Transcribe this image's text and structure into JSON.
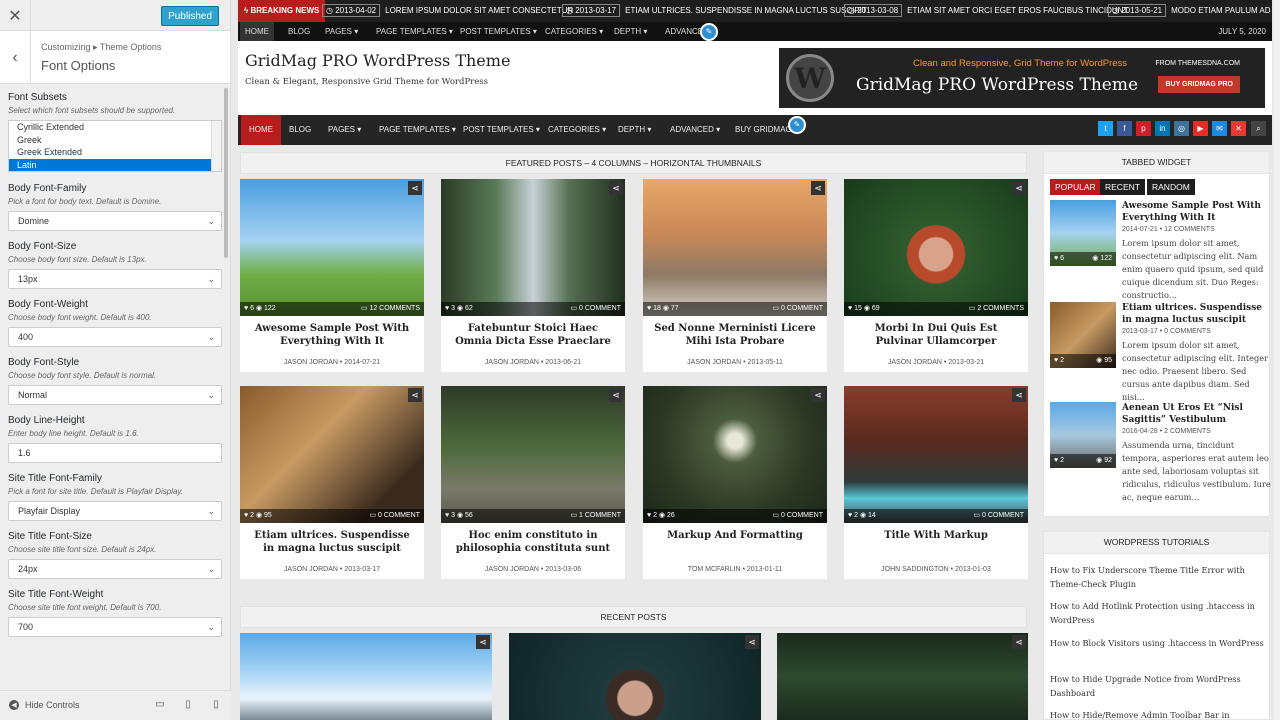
{
  "customizer": {
    "close_glyph": "✕",
    "publish_label": "Published",
    "back_glyph": "‹",
    "breadcrumb": "Customizing ▸ Theme Options",
    "section_title": "Font Options",
    "subsets": {
      "label": "Font Subsets",
      "desc": "Select which font subsets should be supported.",
      "items": [
        "Cyrillic Extended",
        "Greek",
        "Greek Extended",
        "Latin"
      ]
    },
    "controls": [
      {
        "label": "Body Font-Family",
        "desc": "Pick a font for body text. Default is Domine.",
        "value": "Domine"
      },
      {
        "label": "Body Font-Size",
        "desc": "Choose body font size. Default is 13px.",
        "value": "13px"
      },
      {
        "label": "Body Font-Weight",
        "desc": "Choose body font weight. Default is 400.",
        "value": "400"
      },
      {
        "label": "Body Font-Style",
        "desc": "Choose body font style. Default is normal.",
        "value": "Normal"
      },
      {
        "label": "Body Line-Height",
        "desc": "Enter body line height. Default is 1.6.",
        "value": "1.6"
      },
      {
        "label": "Site Title Font-Family",
        "desc": "Pick a font for site title. Default is Playfair Display.",
        "value": "Playfair Display"
      },
      {
        "label": "Site Title Font-Size",
        "desc": "Choose site title font size. Default is 24px.",
        "value": "24px"
      },
      {
        "label": "Site Title Font-Weight",
        "desc": "Choose site title font weight. Default is 700.",
        "value": "700"
      }
    ],
    "hide_controls": "Hide Controls"
  },
  "ticker": {
    "label": "BREAKING NEWS",
    "items": [
      {
        "date": "2013-04-02",
        "text": "LOREM IPSUM DOLOR SIT AMET CONSECTETUR"
      },
      {
        "date": "2013-03-17",
        "text": "ETIAM ULTRICES. SUSPENDISSE IN MAGNA LUCTUS SUSCIPIT"
      },
      {
        "date": "2013-03-08",
        "text": "ETIAM SIT AMET ORCI EGET EROS FAUCIBUS TINCIDUNT"
      },
      {
        "date": "2013-05-21",
        "text": "MODO ETIAM PAULUM AD DEXTE"
      }
    ]
  },
  "top_nav": {
    "items": [
      "HOME",
      "BLOG",
      "PAGES ▾",
      "PAGE TEMPLATES ▾",
      "POST TEMPLATES ▾",
      "CATEGORIES ▾",
      "DEPTH ▾",
      "ADVANCED"
    ],
    "date": "JULY 5, 2020"
  },
  "site": {
    "title": "GridMag PRO WordPress Theme",
    "tagline": "Clean & Elegant, Responsive Grid Theme for WordPress"
  },
  "banner": {
    "logo": "W",
    "tagline": "Clean and Responsive, Grid Theme for WordPress",
    "title": "GridMag PRO WordPress Theme",
    "from": "FROM THEMESDNA.COM",
    "buy": "BUY GRIDMAG PRO"
  },
  "main_nav": {
    "items": [
      "HOME",
      "BLOG",
      "PAGES ▾",
      "PAGE TEMPLATES ▾",
      "POST TEMPLATES ▾",
      "CATEGORIES ▾",
      "DEPTH ▾",
      "ADVANCED ▾",
      "BUY GRIDMAG P"
    ],
    "social": [
      "t",
      "f",
      "p",
      "in",
      "◎",
      "▶",
      "✉",
      "✕",
      "⇥",
      "⌕"
    ]
  },
  "featured": {
    "heading": "FEATURED POSTS – 4 COLUMNS – HORIZONTAL THUMBNAILS",
    "posts": [
      {
        "likes": "6",
        "views": "122",
        "comments": "12 COMMENTS",
        "title": "Awesome Sample Post With Everything With It",
        "author": "JASON JORDAN",
        "date": "2014-07-21"
      },
      {
        "likes": "3",
        "views": "62",
        "comments": "0 COMMENT",
        "title": "Fatebuntur Stoici Haec Omnia Dicta Esse Praeclare",
        "author": "JASON JORDAN",
        "date": "2013-06-21"
      },
      {
        "likes": "18",
        "views": "77",
        "comments": "0 COMMENT",
        "title": "Sed Nonne Merninisti Licere Mihi Ista Probare",
        "author": "JASON JORDAN",
        "date": "2013-05-11"
      },
      {
        "likes": "15",
        "views": "69",
        "comments": "2 COMMENTS",
        "title": "Morbi In Dui Quis Est Pulvinar Ullamcorper",
        "author": "JASON JORDAN",
        "date": "2013-03-21"
      },
      {
        "likes": "2",
        "views": "95",
        "comments": "0 COMMENT",
        "title": "Etiam ultrices. Suspendisse in magna luctus suscipit",
        "author": "JASON JORDAN",
        "date": "2013-03-17"
      },
      {
        "likes": "3",
        "views": "56",
        "comments": "1 COMMENT",
        "title": "Hoc enim constituto in philosophia constituta sunt",
        "author": "JASON JORDAN",
        "date": "2013-03-06"
      },
      {
        "likes": "2",
        "views": "26",
        "comments": "0 COMMENT",
        "title": "Markup And Formatting",
        "author": "TOM MCFARLIN",
        "date": "2013-01-11"
      },
      {
        "likes": "2",
        "views": "14",
        "comments": "0 COMMENT",
        "title": "Title With Markup",
        "author": "JOHN SADDINGTON",
        "date": "2013-01-03"
      }
    ]
  },
  "recent": {
    "heading": "RECENT POSTS"
  },
  "tabbed": {
    "heading": "TABBED WIDGET",
    "tabs": [
      "POPULAR",
      "RECENT",
      "RANDOM"
    ],
    "items": [
      {
        "title": "Awesome Sample Post With Everything With It",
        "date": "2014-07-21 • 12 COMMENTS",
        "excerpt": "Lorem ipsum dolor sit amet, consectetur adipiscing elit. Nam enim quaero quid ipsum, sed quid cuique dicendum sit. Duo Reges: constructio…",
        "likes": "6",
        "views": "122"
      },
      {
        "title": "Etiam ultrices. Suspendisse in magna luctus suscipit",
        "date": "2013-03-17 • 0 COMMENTS",
        "excerpt": "Lorem ipsum dolor sit amet, consectetur adipiscing elit. Integer nec odio. Praesent libero. Sed cursus ante dapibus diam. Sed nisi…",
        "likes": "2",
        "views": "95"
      },
      {
        "title": "Aenean Ut Eros Et “Nisl Sagittis” Vestibulum",
        "date": "2016-04-28 • 2 COMMENTS",
        "excerpt": "Assumenda urna, tincidunt tempora, asperiores erat autem leo ante sed, laboriosam voluptas sit ridiculus, ridiculus vestibulum. Iure ac, neque earum…",
        "likes": "2",
        "views": "92"
      }
    ]
  },
  "tutorials": {
    "heading": "WORDPRESS TUTORIALS",
    "items": [
      "How to Fix Underscore Theme Title Error with Theme-Check Plugin",
      "How to Add Hotlink Protection using .htaccess in WordPress",
      "How to Block Visitors using .htaccess in WordPress",
      "How to Hide Upgrade Notice from WordPress Dashboard",
      "How to Hide/Remove Admin Toolbar Bar in"
    ]
  },
  "colors": {
    "accent_red": "#b91c1c",
    "publish_blue": "#2ea2cc",
    "nav_dark": "#252525"
  }
}
